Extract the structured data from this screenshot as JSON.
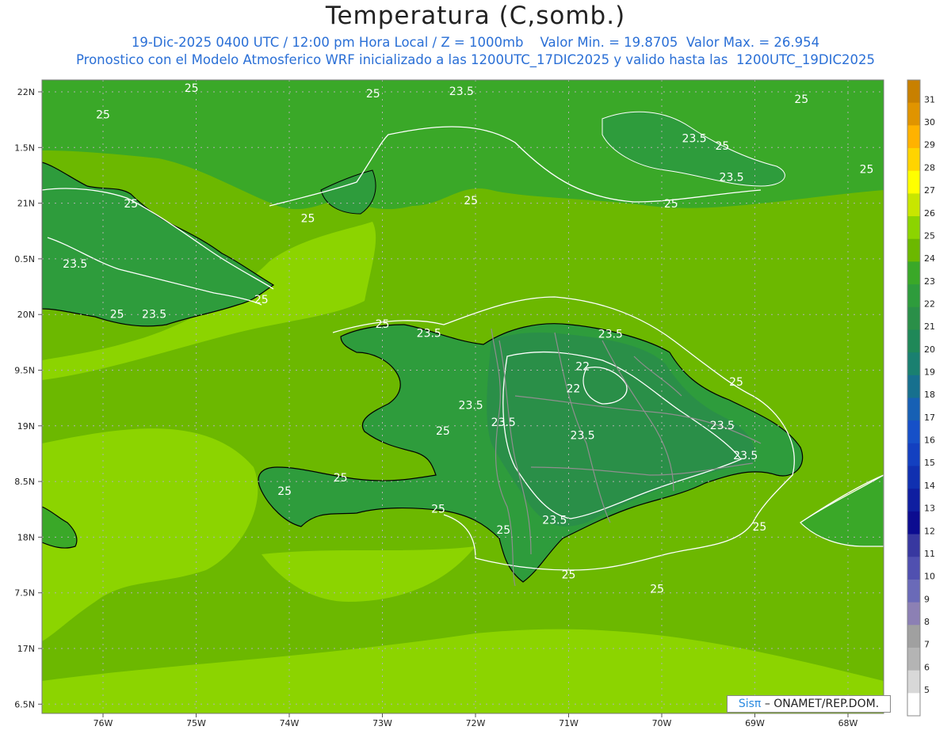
{
  "title": "Temperatura (C,somb.)",
  "subtitle_line1": {
    "date_time": "19-Dic-2025 0400 UTC / 12:00 pm Hora Local / Z = 1000mb",
    "min_label": "Valor Min. = 19.8705",
    "max_label": "Valor Max. = 26.954"
  },
  "subtitle_line2": "Pronostico con el Modelo Atmosferico WRF inicializado a las 1200UTC_17DIC2025 y valido hasta las  1200UTC_19DIC2025",
  "credit": {
    "sis": "Sisπ",
    "org": "– ONAMET/REP.DOM."
  },
  "colors": {
    "ocean_warm": "#8cd400",
    "ocean": "#6cb800",
    "land_25": "#3aa828",
    "land_24": "#2e9c3c",
    "land_23": "#2a8f48",
    "contour": "#ffffff",
    "coast": "#000000",
    "border": "#8f8f8f"
  },
  "axes": {
    "lon_labels": [
      "76W",
      "75W",
      "74W",
      "73W",
      "72W",
      "71W",
      "70W",
      "69W",
      "68W"
    ],
    "lat_labels": [
      "22N",
      "1.5N",
      "21N",
      "0.5N",
      "20N",
      "9.5N",
      "19N",
      "8.5N",
      "18N",
      "7.5N",
      "17N",
      "6.5N"
    ]
  },
  "colorbar": {
    "labels": [
      "31",
      "30",
      "29",
      "28",
      "27",
      "26",
      "25",
      "24",
      "23",
      "22",
      "21",
      "20",
      "19",
      "18",
      "17",
      "16",
      "15",
      "14",
      "13",
      "12",
      "11",
      "10",
      "9",
      "8",
      "7",
      "6",
      "5"
    ],
    "colors": [
      "#c88000",
      "#e09400",
      "#ffb200",
      "#ffd400",
      "#ffff00",
      "#c8e600",
      "#8cd400",
      "#6cb800",
      "#3aa828",
      "#2e9c3c",
      "#2a8f48",
      "#1f8858",
      "#1a8070",
      "#17708e",
      "#1760b4",
      "#1650c8",
      "#1340c0",
      "#1030b0",
      "#0f1ea0",
      "#0c0c90",
      "#3838a0",
      "#5050b0",
      "#6a6ab8",
      "#8c80b4",
      "#a0a0a0",
      "#b4b4b4",
      "#d8d8d8",
      "#ffffff"
    ]
  },
  "contour_labels": [
    {
      "text": "25",
      "lon": -75.05,
      "lat": 22.0
    },
    {
      "text": "25",
      "lon": -73.1,
      "lat": 21.95
    },
    {
      "text": "23.5",
      "lon": -72.15,
      "lat": 21.97
    },
    {
      "text": "25",
      "lon": -68.5,
      "lat": 21.9
    },
    {
      "text": "25",
      "lon": -76.0,
      "lat": 21.76
    },
    {
      "text": "23.5",
      "lon": -69.65,
      "lat": 21.55
    },
    {
      "text": "25",
      "lon": -69.35,
      "lat": 21.48
    },
    {
      "text": "23.5",
      "lon": -69.25,
      "lat": 21.2
    },
    {
      "text": "25",
      "lon": -67.8,
      "lat": 21.27
    },
    {
      "text": "25",
      "lon": -72.05,
      "lat": 20.99
    },
    {
      "text": "25",
      "lon": -69.9,
      "lat": 20.96
    },
    {
      "text": "25",
      "lon": -75.7,
      "lat": 20.96
    },
    {
      "text": "25",
      "lon": -73.8,
      "lat": 20.83
    },
    {
      "text": "23.5",
      "lon": -76.3,
      "lat": 20.42
    },
    {
      "text": "25",
      "lon": -74.3,
      "lat": 20.1
    },
    {
      "text": "25",
      "lon": -75.85,
      "lat": 19.97
    },
    {
      "text": "23.5",
      "lon": -75.45,
      "lat": 19.97
    },
    {
      "text": "25",
      "lon": -73.0,
      "lat": 19.88
    },
    {
      "text": "23.5",
      "lon": -72.5,
      "lat": 19.8
    },
    {
      "text": "23.5",
      "lon": -70.55,
      "lat": 19.79
    },
    {
      "text": "22",
      "lon": -70.85,
      "lat": 19.5
    },
    {
      "text": "22",
      "lon": -70.95,
      "lat": 19.3
    },
    {
      "text": "25",
      "lon": -69.2,
      "lat": 19.36
    },
    {
      "text": "23.5",
      "lon": -72.05,
      "lat": 19.15
    },
    {
      "text": "23.5",
      "lon": -71.7,
      "lat": 19.0
    },
    {
      "text": "25",
      "lon": -72.35,
      "lat": 18.92
    },
    {
      "text": "23.5",
      "lon": -70.85,
      "lat": 18.88
    },
    {
      "text": "23.5",
      "lon": -69.35,
      "lat": 18.97
    },
    {
      "text": "23.5",
      "lon": -69.1,
      "lat": 18.7
    },
    {
      "text": "25",
      "lon": -73.45,
      "lat": 18.5
    },
    {
      "text": "25",
      "lon": -74.05,
      "lat": 18.38
    },
    {
      "text": "25",
      "lon": -72.4,
      "lat": 18.22
    },
    {
      "text": "23.5",
      "lon": -71.15,
      "lat": 18.12
    },
    {
      "text": "25",
      "lon": -71.7,
      "lat": 18.03
    },
    {
      "text": "25",
      "lon": -68.95,
      "lat": 18.06
    },
    {
      "text": "25",
      "lon": -71.0,
      "lat": 17.63
    },
    {
      "text": "25",
      "lon": -70.05,
      "lat": 17.5
    }
  ]
}
